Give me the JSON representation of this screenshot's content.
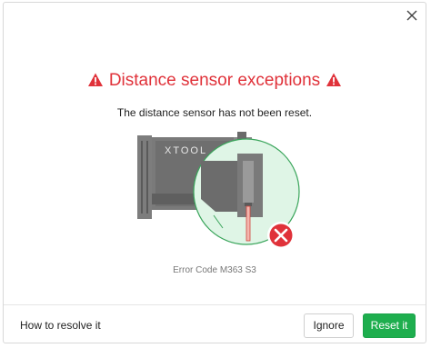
{
  "dialog": {
    "title": "Distance sensor exceptions",
    "message": "The distance sensor has not been reset.",
    "error_code": "Error Code M363 S3",
    "illustration_logo": "XTOOL",
    "close_icon": "close-icon",
    "warning_icon": "warning-triangle-icon",
    "error_badge_icon": "error-x-icon"
  },
  "footer": {
    "help_link": "How to resolve it",
    "ignore_label": "Ignore",
    "reset_label": "Reset it"
  },
  "colors": {
    "title_red": "#e0323a",
    "reset_green": "#1eae4e",
    "zoom_circle_fill": "#dff5e6"
  }
}
